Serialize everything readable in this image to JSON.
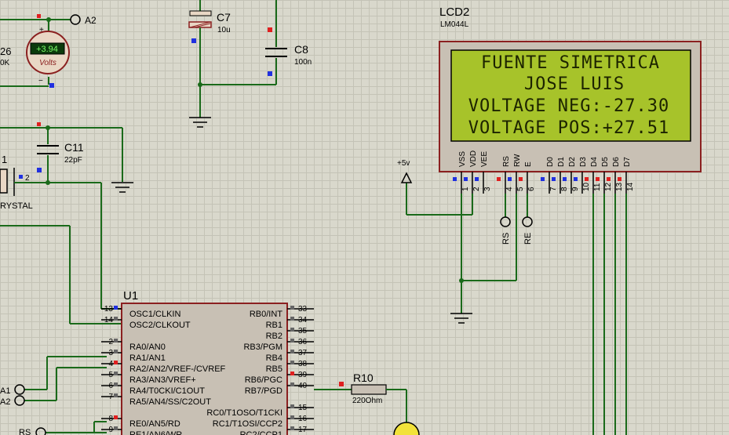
{
  "components": {
    "c7": {
      "ref": "C7",
      "value": "10u"
    },
    "c8": {
      "ref": "C8",
      "value": "100n"
    },
    "c11": {
      "ref": "C11",
      "value": "22pF"
    },
    "r6": {
      "ref": "26",
      "value": "0K"
    },
    "voltmeter": {
      "reading": "+3.94",
      "unit": "Volts",
      "plus": "+",
      "minus": "−"
    },
    "crystal": {
      "ref": "1",
      "value": "RYSTAL",
      "pin": "2"
    },
    "lcd": {
      "ref": "LCD2",
      "model": "LM044L",
      "lines": [
        "FUENTE SIMETRICA",
        "JOSE LUIS",
        "VOLTAGE NEG:-27.30",
        "VOLTAGE POS:+27.51"
      ],
      "backlight_color": "#a7c32a"
    },
    "u1": {
      "ref": "U1"
    },
    "r10": {
      "ref": "R10",
      "value": "220Ohm"
    }
  },
  "terminals": {
    "a2_top": "A2",
    "plus5v": "+5v",
    "rs": "RS",
    "re": "RE",
    "a1": "A1",
    "a2": "A2",
    "rs_bottom": "RS"
  },
  "lcd_pins": [
    {
      "name": "VSS",
      "num": "1"
    },
    {
      "name": "VDD",
      "num": "2"
    },
    {
      "name": "VEE",
      "num": "3"
    },
    {
      "name": "RS",
      "num": "4"
    },
    {
      "name": "RW",
      "num": "5"
    },
    {
      "name": "E",
      "num": "6"
    },
    {
      "name": "D0",
      "num": "7"
    },
    {
      "name": "D1",
      "num": "8"
    },
    {
      "name": "D2",
      "num": "9"
    },
    {
      "name": "D3",
      "num": "10"
    },
    {
      "name": "D4",
      "num": "11"
    },
    {
      "name": "D5",
      "num": "12"
    },
    {
      "name": "D6",
      "num": "13"
    },
    {
      "name": "D7",
      "num": "14"
    }
  ],
  "u1_left_pins": [
    {
      "name": "OSC1/CLKIN",
      "num": "13"
    },
    {
      "name": "OSC2/CLKOUT",
      "num": "14"
    },
    {
      "name": "RA0/AN0",
      "num": "2"
    },
    {
      "name": "RA1/AN1",
      "num": "3"
    },
    {
      "name": "RA2/AN2/VREF-/CVREF",
      "num": "4"
    },
    {
      "name": "RA3/AN3/VREF+",
      "num": "5"
    },
    {
      "name": "RA4/T0CKI/C1OUT",
      "num": "6"
    },
    {
      "name": "RA5/AN4/SS/C2OUT",
      "num": "7"
    },
    {
      "name": "RE0/AN5/RD",
      "num": "8"
    },
    {
      "name": "RE1/AN6/WR",
      "num": "9"
    }
  ],
  "u1_right_pins": [
    {
      "name": "RB0/INT",
      "num": "33"
    },
    {
      "name": "RB1",
      "num": "34"
    },
    {
      "name": "RB2",
      "num": "35"
    },
    {
      "name": "RB3/PGM",
      "num": "36"
    },
    {
      "name": "RB4",
      "num": "37"
    },
    {
      "name": "RB5",
      "num": "38"
    },
    {
      "name": "RB6/PGC",
      "num": "39"
    },
    {
      "name": "RB7/PGD",
      "num": "40"
    },
    {
      "name": "RC0/T1OSO/T1CKI",
      "num": "15"
    },
    {
      "name": "RC1/T1OSI/CCP2",
      "num": "16"
    },
    {
      "name": "RC2/CCP1",
      "num": "17"
    }
  ],
  "colors": {
    "wire": "#1a6a1a",
    "chip_body": "#c8c0b4",
    "chip_border": "#8b2020",
    "pin_hi": "#e02020",
    "pin_lo": "#2030e0"
  }
}
